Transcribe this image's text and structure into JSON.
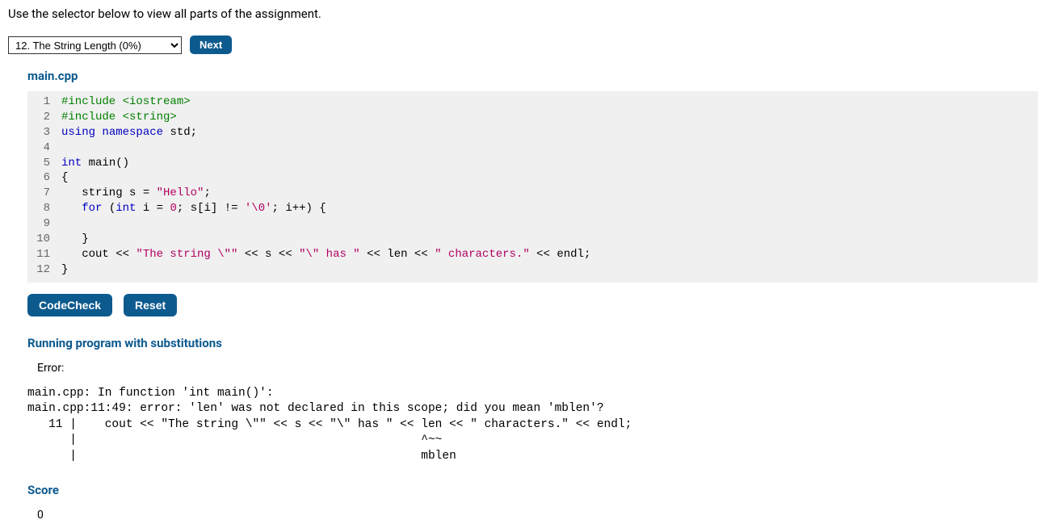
{
  "instruction": "Use the selector below to view all parts of the assignment.",
  "selector": {
    "selected": "12. The String Length (0%)",
    "next_label": "Next"
  },
  "filename": "main.cpp",
  "code": {
    "lines": [
      {
        "n": 1,
        "html": "<span class='tok-pp'>#include &lt;iostream&gt;</span>"
      },
      {
        "n": 2,
        "html": "<span class='tok-pp'>#include &lt;string&gt;</span>"
      },
      {
        "n": 3,
        "html": "<span class='tok-kw'>using</span> <span class='tok-kw'>namespace</span> std;"
      },
      {
        "n": 4,
        "html": ""
      },
      {
        "n": 5,
        "html": "<span class='tok-type'>int</span> main()"
      },
      {
        "n": 6,
        "html": "{"
      },
      {
        "n": 7,
        "html": "   string s = <span class='tok-str'>\"Hello\"</span>;"
      },
      {
        "n": 8,
        "html": "   <span class='tok-kw'>for</span> (<span class='tok-type'>int</span> i = <span class='tok-num'>0</span>; s[i] != <span class='tok-char'>'\\0'</span>; i++) {"
      },
      {
        "n": 9,
        "html": ""
      },
      {
        "n": 10,
        "html": "   }"
      },
      {
        "n": 11,
        "html": "   cout &lt;&lt; <span class='tok-str'>\"The string \\\"\"</span> &lt;&lt; s &lt;&lt; <span class='tok-str'>\"\\\" has \"</span> &lt;&lt; len &lt;&lt; <span class='tok-str'>\" characters.\"</span> &lt;&lt; endl;"
      },
      {
        "n": 12,
        "html": "}"
      }
    ]
  },
  "buttons": {
    "codecheck": "CodeCheck",
    "reset": "Reset"
  },
  "result": {
    "heading": "Running program with substitutions",
    "error_label": "Error:",
    "error_output": "main.cpp: In function 'int main()':\nmain.cpp:11:49: error: 'len' was not declared in this scope; did you mean 'mblen'?\n   11 |    cout << \"The string \\\"\" << s << \"\\\" has \" << len << \" characters.\" << endl;\n      |                                                 ^~~\n      |                                                 mblen"
  },
  "score": {
    "heading": "Score",
    "value": "0"
  }
}
